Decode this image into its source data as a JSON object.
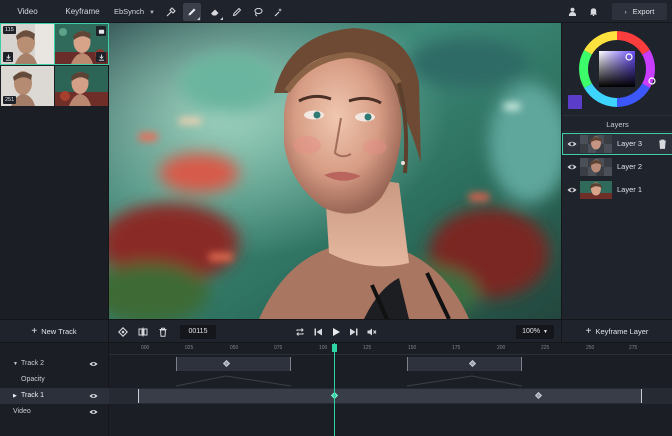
{
  "tabs": {
    "video": "Video",
    "keyframe": "Keyframe"
  },
  "toolbar": {
    "plugin_label": "EbSynch",
    "tools": [
      "brush-tool-icon",
      "pen-icon",
      "eraser-icon",
      "pencil-icon",
      "lasso-icon",
      "magic-wand-icon"
    ],
    "export_label": "Export"
  },
  "thumbnails": [
    {
      "badge": "115",
      "selected": true
    },
    {
      "badge": "",
      "selected": true
    },
    {
      "badge": "251",
      "selected": false
    },
    {
      "badge": "",
      "selected": false
    }
  ],
  "layers": {
    "title": "Layers",
    "items": [
      {
        "name": "Layer 3",
        "selected": true
      },
      {
        "name": "Layer 2",
        "selected": false
      },
      {
        "name": "Layer 1",
        "selected": false
      }
    ]
  },
  "colors": {
    "accent": "#2fd4a5",
    "swatch": "#5a3dc8",
    "panel": "#1f232b",
    "background": "#1b1e25"
  },
  "transport": {
    "new_track_label": "New Track",
    "frame": "00115",
    "zoom": "100%",
    "keyframe_layer_label": "Keyframe Layer"
  },
  "timeline": {
    "ruler_ticks": [
      "000",
      "025",
      "050",
      "075",
      "100",
      "125",
      "150",
      "175",
      "200",
      "225",
      "250",
      "275"
    ],
    "rows": [
      {
        "label": "Track 2",
        "expandable": true,
        "selected": false
      },
      {
        "label": "Opacity",
        "expandable": false,
        "selected": false
      },
      {
        "label": "Track 1",
        "expandable": true,
        "selected": true
      },
      {
        "label": "Video",
        "expandable": false,
        "selected": false
      }
    ]
  }
}
